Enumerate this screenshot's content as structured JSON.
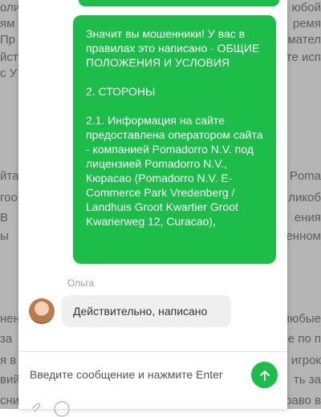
{
  "background_page": {
    "left_lines": [
      "оли",
      "ям",
      "Пр",
      "йст",
      "с У",
      "йта",
      "гоо",
      "В",
      "ы",
      "нен",
      "за",
      "я в",
      "вий",
      "сни"
    ],
    "right_lines": [
      "юбой",
      "ремя",
      "имател",
      "те исп",
      "Pomа",
      "ликоб",
      "ения",
      "енном",
      "любые",
      "ре по п",
      "игрок",
      "ть за",
      "раво в"
    ]
  },
  "chat": {
    "outgoing_message": "Значит вы мошенники! У вас в правилах это написано - ОБЩИЕ ПОЛОЖЕНИЯ И УСЛОВИЯ\n\n2. СТОРОНЫ\n\n2.1. Информация на сайте предоставлена оператором сайта - компанией Pomadorro N.V. под лицензией Pomadorro N.V., Кюрасао (Pomadorro N.V. E-Commerce Park Vredenberg / Landhuis Groot Kwartier Groot Kwarierweg 12, Curacao),",
    "agent_name": "Ольга",
    "incoming_message": "Действительно, написано",
    "input_placeholder": "Введите сообщение и нажмите Enter",
    "accent_color": "#1cbd49",
    "icons": {
      "send": "arrow-up-icon",
      "attach": "paperclip-icon",
      "emoji": "emoji-icon"
    }
  }
}
